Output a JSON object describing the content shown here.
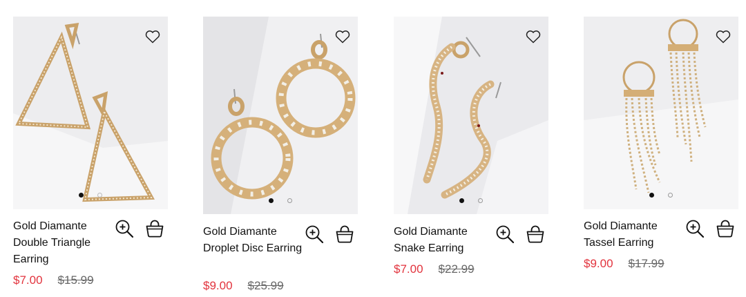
{
  "colors": {
    "sale_price": "#e2333d",
    "original_price": "#666666",
    "text": "#111111"
  },
  "products": [
    {
      "name": "Gold Diamante Double Triangle Earring",
      "price_now": "$7.00",
      "price_was": "$15.99",
      "image_count": 2,
      "active_image": 1
    },
    {
      "name": "Gold Diamante Droplet Disc Earring",
      "price_now": "$9.00",
      "price_was": "$25.99",
      "image_count": 2,
      "active_image": 1
    },
    {
      "name": "Gold Diamante Snake Earring",
      "price_now": "$7.00",
      "price_was": "$22.99",
      "image_count": 2,
      "active_image": 1
    },
    {
      "name": "Gold Diamante Tassel Earring",
      "price_now": "$9.00",
      "price_was": "$17.99",
      "image_count": 2,
      "active_image": 1
    }
  ],
  "icons": {
    "wishlist": "heart-icon",
    "quick_view": "zoom-plus-icon",
    "add_to_bag": "shopping-bag-icon"
  }
}
